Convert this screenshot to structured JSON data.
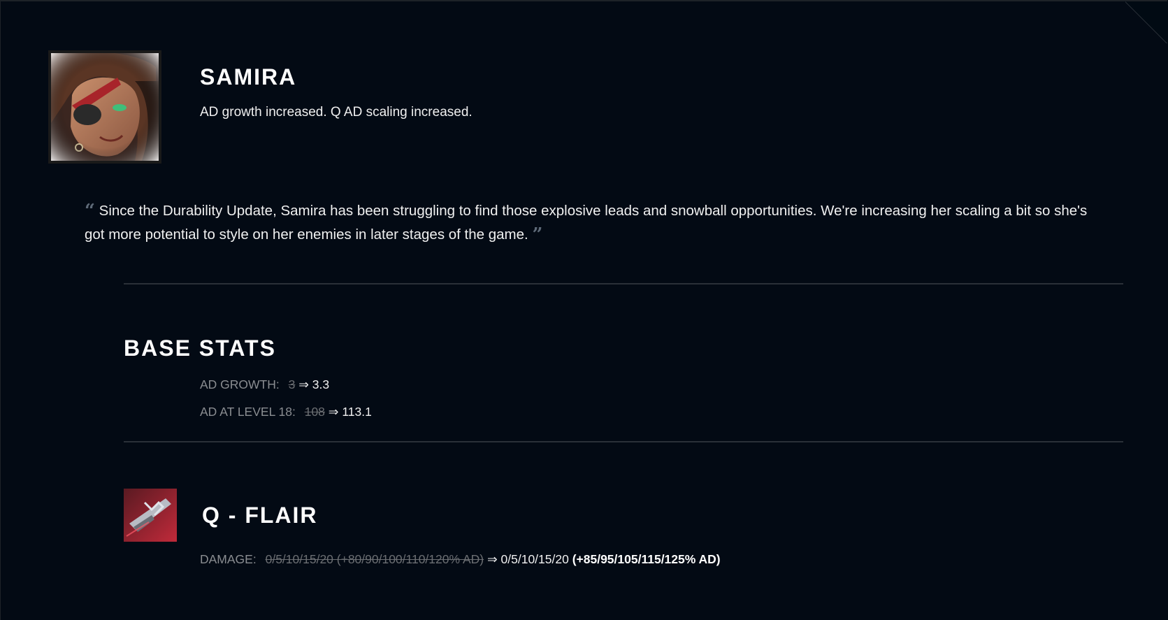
{
  "champion": {
    "name": "SAMIRA",
    "summary": "AD growth increased. Q AD scaling increased.",
    "portrait_icon": "samira-portrait-icon"
  },
  "context": {
    "open_quote": "“",
    "text": "Since the Durability Update, Samira has been struggling to find those explosive leads and snowball opportunities. We're increasing her scaling a bit so she's got more potential to style on her enemies in later stages of the game.",
    "close_quote": "”"
  },
  "base_stats": {
    "title": "BASE STATS",
    "rows": [
      {
        "label": "AD GROWTH:",
        "old": "3",
        "arrow": "⇒",
        "new": "3.3"
      },
      {
        "label": "AD AT LEVEL 18:",
        "old": "108",
        "arrow": "⇒",
        "new": "113.1"
      }
    ]
  },
  "ability": {
    "title": "Q - FLAIR",
    "icon": "flair-ability-icon",
    "rows": [
      {
        "label": "DAMAGE:",
        "old": "0/5/10/15/20 (+80/90/100/110/120% AD)",
        "arrow": "⇒",
        "new": "0/5/10/15/20",
        "new_bold": "(+85/95/105/115/125% AD)"
      }
    ]
  },
  "colors": {
    "background": "#030a14",
    "divider": "#2a3038",
    "label": "#8a8d91",
    "text": "#f0f0f0"
  }
}
